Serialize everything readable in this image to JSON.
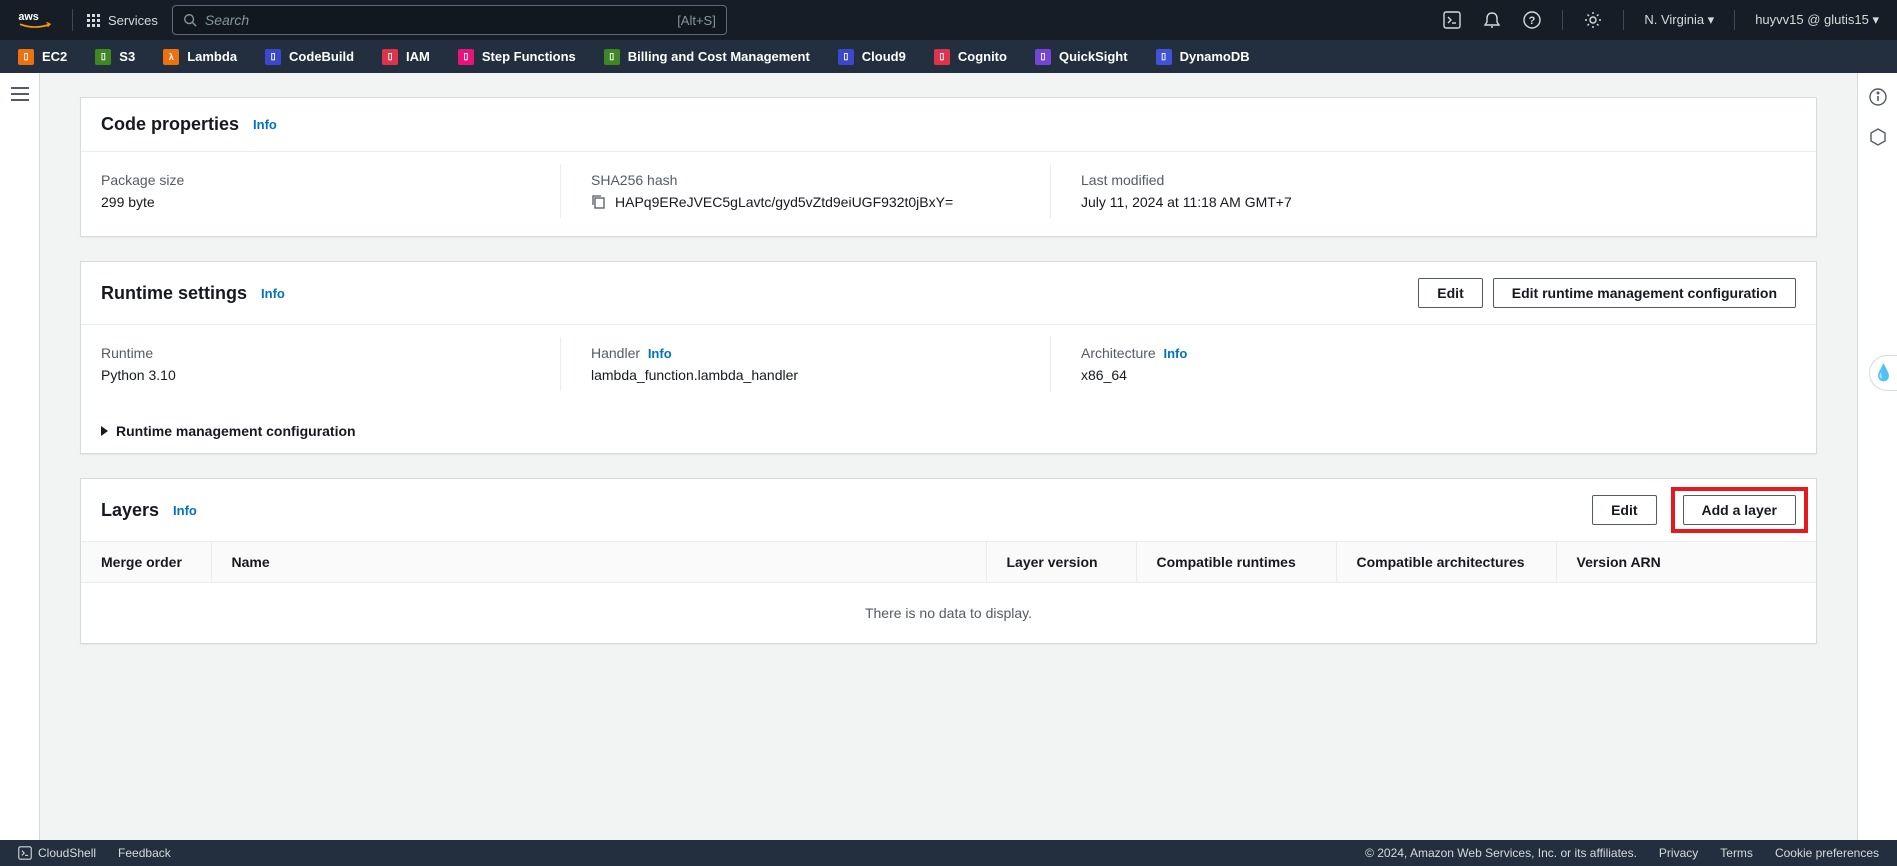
{
  "header": {
    "services_label": "Services",
    "search_placeholder": "Search",
    "search_shortcut": "[Alt+S]",
    "region": "N. Virginia",
    "account": "huyvv15 @ glutis15"
  },
  "service_nav": {
    "items": [
      {
        "label": "EC2",
        "color": "#ec7211"
      },
      {
        "label": "S3",
        "color": "#3f8624"
      },
      {
        "label": "Lambda",
        "color": "#ec7211"
      },
      {
        "label": "CodeBuild",
        "color": "#3b48cc"
      },
      {
        "label": "IAM",
        "color": "#dd344c"
      },
      {
        "label": "Step Functions",
        "color": "#e7157b"
      },
      {
        "label": "Billing and Cost Management",
        "color": "#3f8624"
      },
      {
        "label": "Cloud9",
        "color": "#3b48cc"
      },
      {
        "label": "Cognito",
        "color": "#dd344c"
      },
      {
        "label": "QuickSight",
        "color": "#7545d6"
      },
      {
        "label": "DynamoDB",
        "color": "#4053d6"
      }
    ]
  },
  "code_props": {
    "title": "Code properties",
    "info": "Info",
    "package_size_label": "Package size",
    "package_size_value": "299 byte",
    "sha_label": "SHA256 hash",
    "sha_value": "HAPq9EReJVEC5gLavtc/gyd5vZtd9eiUGF932t0jBxY=",
    "modified_label": "Last modified",
    "modified_value": "July 11, 2024 at 11:18 AM GMT+7"
  },
  "runtime": {
    "title": "Runtime settings",
    "info": "Info",
    "edit": "Edit",
    "edit_mgmt": "Edit runtime management configuration",
    "runtime_label": "Runtime",
    "runtime_value": "Python 3.10",
    "handler_label": "Handler",
    "handler_info": "Info",
    "handler_value": "lambda_function.lambda_handler",
    "arch_label": "Architecture",
    "arch_info": "Info",
    "arch_value": "x86_64",
    "expand_label": "Runtime management configuration"
  },
  "layers": {
    "title": "Layers",
    "info": "Info",
    "edit": "Edit",
    "add": "Add a layer",
    "columns": {
      "merge": "Merge order",
      "name": "Name",
      "version": "Layer version",
      "runtimes": "Compatible runtimes",
      "archs": "Compatible architectures",
      "arn": "Version ARN"
    },
    "empty": "There is no data to display."
  },
  "footer": {
    "cloudshell": "CloudShell",
    "feedback": "Feedback",
    "copyright": "© 2024, Amazon Web Services, Inc. or its affiliates.",
    "privacy": "Privacy",
    "terms": "Terms",
    "cookies": "Cookie preferences"
  }
}
